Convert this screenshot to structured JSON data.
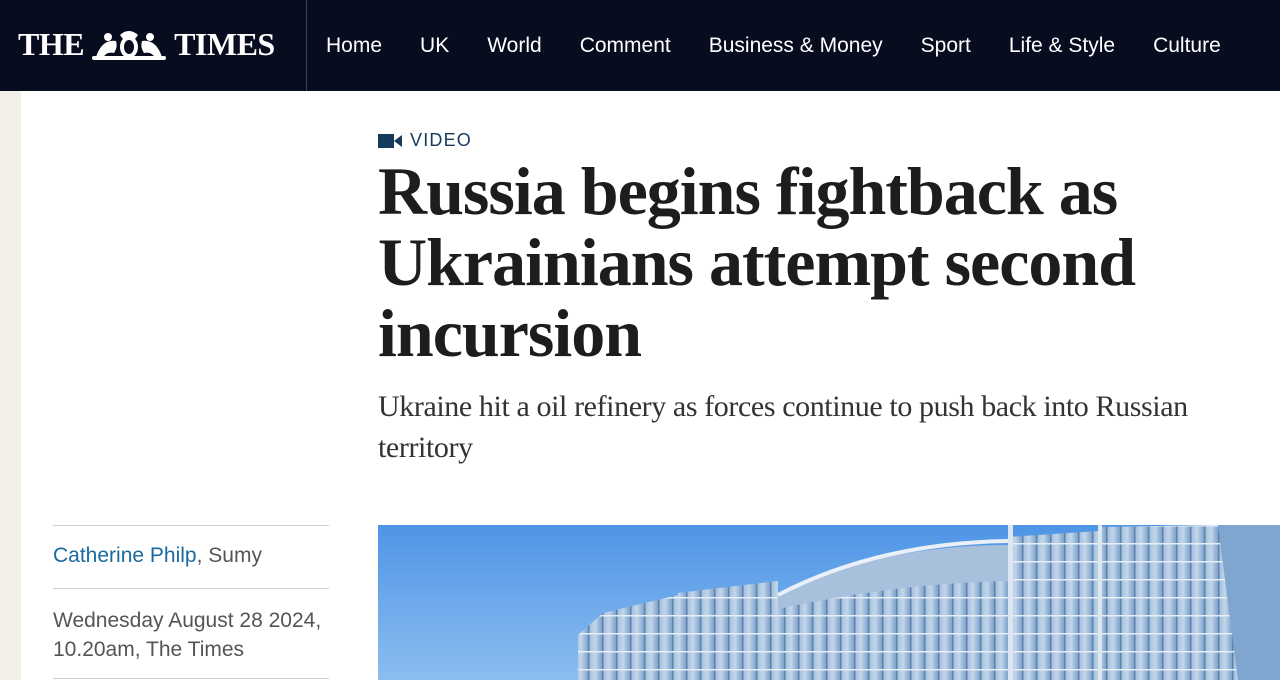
{
  "brand": {
    "logo_text_left": "THE",
    "logo_text_right": "TIMES"
  },
  "nav": {
    "items": [
      "Home",
      "UK",
      "World",
      "Comment",
      "Business & Money",
      "Sport",
      "Life & Style",
      "Culture"
    ]
  },
  "article": {
    "tag": {
      "icon": "video-camera-icon",
      "label": "VIDEO"
    },
    "headline": "Russia begins fightback as Ukrainians attempt second incursion",
    "standfirst": "Ukraine hit a oil refinery as forces continue to push back into Russian territory",
    "author": "Catherine Philp",
    "location": ", Sumy",
    "dateline": "Wednesday August 28 2024, 10.20am, The Times"
  },
  "colors": {
    "nav_bg": "#070d1f",
    "link_blue": "#1a6aa0",
    "tag_blue": "#153a5b",
    "sky": "#6fa8ea"
  }
}
